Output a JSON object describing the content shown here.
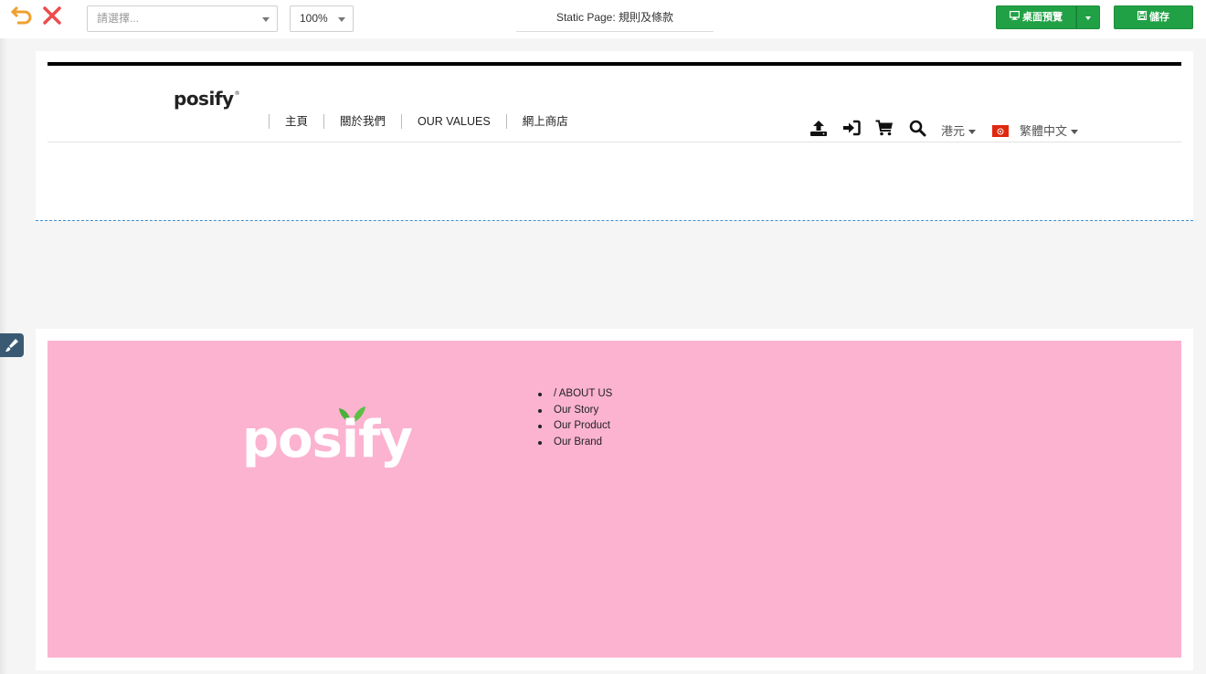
{
  "toolbar": {
    "page_select_placeholder": "請選擇...",
    "zoom_value": "100%",
    "page_title": "Static Page: 規則及條款",
    "preview_label": "桌面預覽",
    "save_label": "儲存"
  },
  "header": {
    "logo_text": "posify",
    "logo_mark": "®",
    "nav": [
      {
        "label": "主頁"
      },
      {
        "label": "關於我們"
      },
      {
        "label": "OUR VALUES"
      },
      {
        "label": "網上商店"
      }
    ],
    "currency": "港元",
    "language": "繁體中文"
  },
  "footer": {
    "logo_text": "posify",
    "links": [
      {
        "label": "/ ABOUT US"
      },
      {
        "label": "Our Story"
      },
      {
        "label": "Our Product"
      },
      {
        "label": "Our Brand"
      }
    ]
  },
  "colors": {
    "brand_green": "#21a145",
    "footer_pink": "#fbb3d0",
    "undo_orange": "#f0a030",
    "close_red": "#ee4b4b",
    "selection_blue": "#3d8fd1"
  },
  "icons": {
    "undo": "undo-icon",
    "close": "close-icon",
    "preview": "monitor-icon",
    "save": "save-icon",
    "upload": "upload-icon",
    "login": "sign-in-icon",
    "cart": "cart-icon",
    "search": "search-icon",
    "flag": "hong-kong-flag-icon",
    "brush": "brush-icon",
    "leaf": "leaf-icon"
  }
}
